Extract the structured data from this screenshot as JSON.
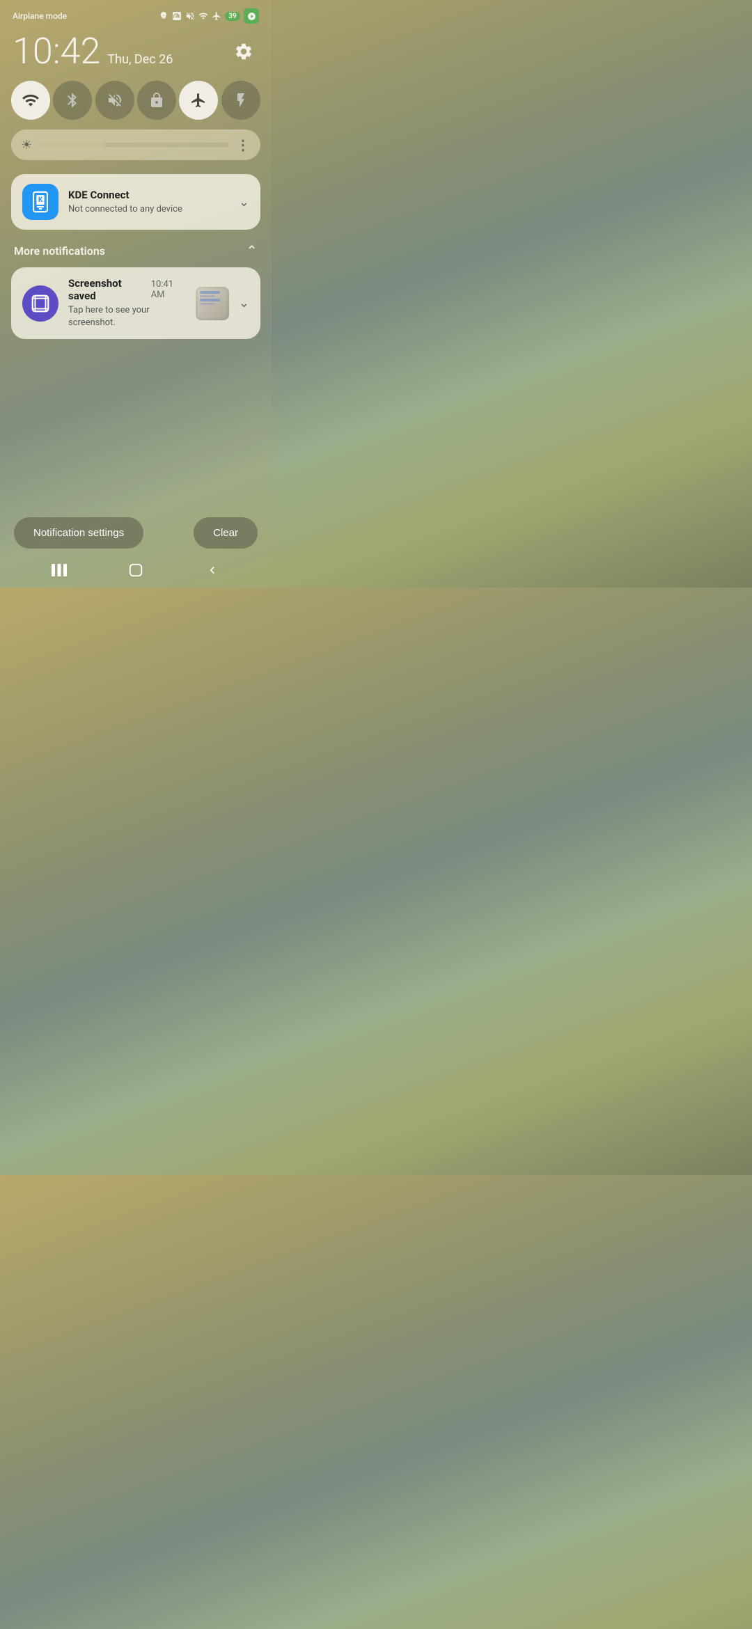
{
  "status_bar": {
    "mode": "Airplane mode",
    "battery": "39",
    "icons": [
      "rotation-lock-icon",
      "nfc-icon",
      "mute-icon",
      "wifi-icon",
      "airplane-icon",
      "battery-icon",
      "camera-icon"
    ]
  },
  "clock": {
    "time": "10:42",
    "date": "Thu, Dec 26"
  },
  "quick_tiles": [
    {
      "id": "wifi",
      "label": "WiFi",
      "active": true
    },
    {
      "id": "bluetooth",
      "label": "Bluetooth",
      "active": false
    },
    {
      "id": "mute",
      "label": "Mute",
      "active": false
    },
    {
      "id": "lock",
      "label": "Screen lock",
      "active": false
    },
    {
      "id": "airplane",
      "label": "Airplane mode",
      "active": true
    },
    {
      "id": "flashlight",
      "label": "Flashlight",
      "active": false
    }
  ],
  "brightness": {
    "level": 35,
    "more_label": "⋮"
  },
  "notifications": [
    {
      "id": "kde-connect",
      "app": "KDE Connect",
      "body": "Not connected to any device",
      "time": "",
      "has_thumbnail": false
    }
  ],
  "more_notifications": {
    "label": "More notifications",
    "items": [
      {
        "id": "screenshot",
        "app": "Screenshot saved",
        "body": "Tap here to see your screenshot.",
        "time": "10:41 AM",
        "has_thumbnail": true
      }
    ]
  },
  "bottom_actions": {
    "settings_label": "Notification settings",
    "clear_label": "Clear"
  },
  "nav_bar": {
    "recents": "|||",
    "home": "○",
    "back": "<"
  }
}
